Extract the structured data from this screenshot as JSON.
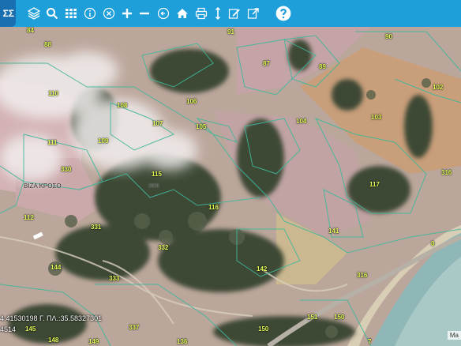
{
  "toolbar": {
    "brand": "ΣΣ",
    "buttons": [
      {
        "name": "layers-icon"
      },
      {
        "name": "search-icon"
      },
      {
        "name": "grid-icon"
      },
      {
        "name": "info-icon"
      },
      {
        "name": "clear-icon"
      },
      {
        "name": "zoom-in-icon"
      },
      {
        "name": "zoom-out-icon"
      },
      {
        "name": "back-icon"
      },
      {
        "name": "home-icon"
      },
      {
        "name": "print-icon"
      },
      {
        "name": "measure-icon"
      },
      {
        "name": "edit-icon"
      },
      {
        "name": "export-icon"
      },
      {
        "name": "help-icon"
      }
    ]
  },
  "map": {
    "parcel_labels": [
      "84",
      "88",
      "91",
      "90",
      "89",
      "87",
      "110",
      "108",
      "106",
      "105",
      "107",
      "104",
      "102",
      "103",
      "111",
      "109",
      "115",
      "330",
      "112",
      "331",
      "116",
      "117",
      "316",
      "141",
      "144",
      "332",
      "333",
      "142",
      "316",
      "0",
      "150",
      "151",
      "150",
      "145",
      "148",
      "149",
      "136",
      "337",
      "7"
    ],
    "place_label": "ΒΙΖΑ ΚΡΟΣΟ",
    "small_label": "2008",
    "coordinates_line1": "4.41530198 Γ. ΠΛ.:35.58327301",
    "coordinates_line2": "4514",
    "attribution": "Ma"
  }
}
